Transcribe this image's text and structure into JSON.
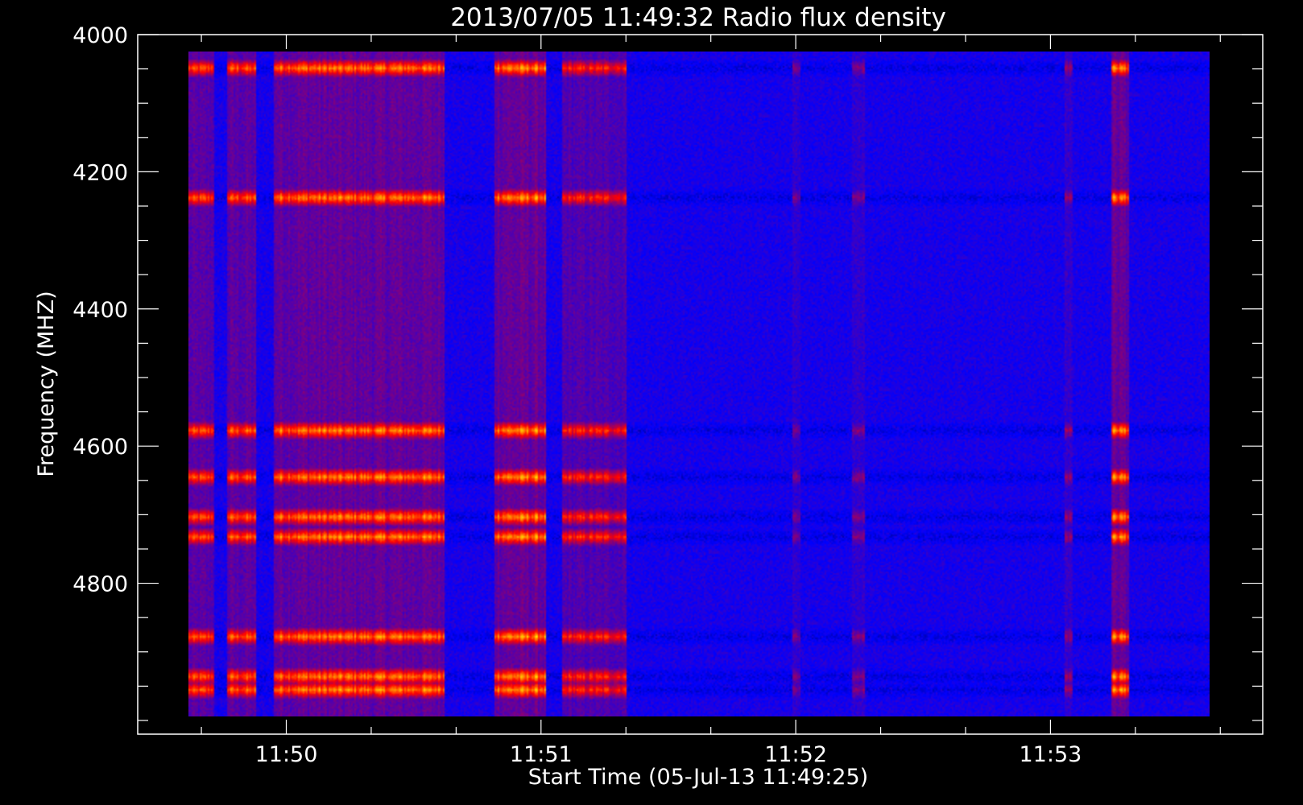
{
  "chart_data": {
    "type": "heatmap",
    "title": "2013/07/05 11:49:32 Radio flux density",
    "xlabel": "Start Time (05-Jul-13 11:49:25)",
    "ylabel": "Frequency (MHZ)",
    "x_tick_labels": [
      "11:50",
      "11:51",
      "11:52",
      "11:53"
    ],
    "y_tick_labels": [
      "4000",
      "4200",
      "4400",
      "4600",
      "4800"
    ],
    "y_ticks": [
      4000,
      4200,
      4400,
      4600,
      4800
    ],
    "ylim": [
      4000,
      5020
    ],
    "y_inverted": true,
    "xlim": [
      "11:49:25",
      "11:53:50"
    ],
    "data_xlim": [
      "11:49:32",
      "11:53:32"
    ],
    "data_ylim": [
      4000,
      5000
    ],
    "colormap": [
      "#000000",
      "#0000ff",
      "#ff0000",
      "#ffff00"
    ],
    "bursts": [
      {
        "start": "11:49:32",
        "end": "11:49:38",
        "intensity": 0.8
      },
      {
        "start": "11:49:41",
        "end": "11:49:48",
        "intensity": 0.85
      },
      {
        "start": "11:49:52",
        "end": "11:50:32",
        "intensity": 0.95
      },
      {
        "start": "11:50:44",
        "end": "11:50:56",
        "intensity": 1.0
      },
      {
        "start": "11:51:00",
        "end": "11:51:15",
        "intensity": 0.7
      },
      {
        "start": "11:51:54",
        "end": "11:51:56",
        "intensity": 0.3
      },
      {
        "start": "11:52:08",
        "end": "11:52:11",
        "intensity": 0.3
      },
      {
        "start": "11:52:58",
        "end": "11:53:00",
        "intensity": 0.35
      },
      {
        "start": "11:53:09",
        "end": "11:53:13",
        "intensity": 1.0
      }
    ],
    "bright_bands_mhz": [
      4025,
      4220,
      4570,
      4640,
      4700,
      4730,
      4880,
      4940,
      4960
    ],
    "grid": false
  }
}
